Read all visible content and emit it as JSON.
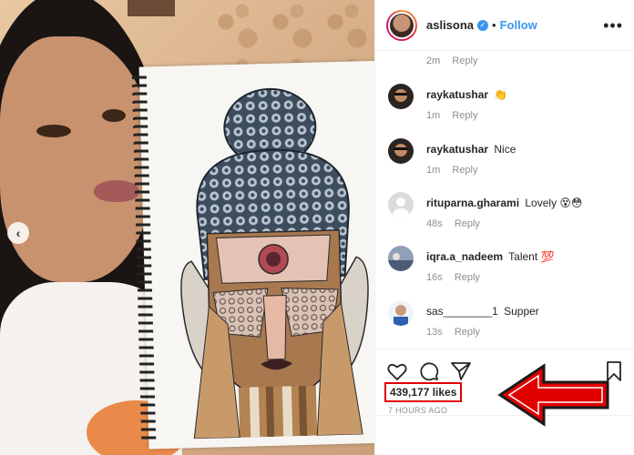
{
  "post": {
    "username": "aslisona",
    "separator": "•",
    "follow_label": "Follow",
    "more_label": "•••"
  },
  "comments": [
    {
      "user": "raykatushar",
      "text": "",
      "emoji": "clapping-hands",
      "time": "1m",
      "reply": "Reply"
    },
    {
      "user": "raykatushar",
      "text": "Nice",
      "emoji": "",
      "time": "1m",
      "reply": "Reply"
    },
    {
      "user": "rituparna.gharami",
      "text": "Lovely",
      "emoji": "face-emojis",
      "time": "48s",
      "reply": "Reply"
    },
    {
      "user": "iqra.a_nadeem",
      "text": "Talent",
      "emoji": "heart-emoji",
      "time": "16s",
      "reply": "Reply"
    },
    {
      "user": "sas________1",
      "text": "Supper",
      "emoji": "",
      "time": "13s",
      "reply": "Reply"
    }
  ],
  "first_meta": {
    "time": "2m",
    "reply": "Reply"
  },
  "likes": "439,177 likes",
  "timestamp": "7 HOURS AGO",
  "colors": {
    "accent": "#3897f0",
    "highlight": "#e10000",
    "muted": "#8e8e8e"
  },
  "icons": [
    "heart-icon",
    "comment-icon",
    "share-icon",
    "bookmark-icon",
    "chevron-left-icon",
    "verified-icon",
    "more-icon"
  ]
}
